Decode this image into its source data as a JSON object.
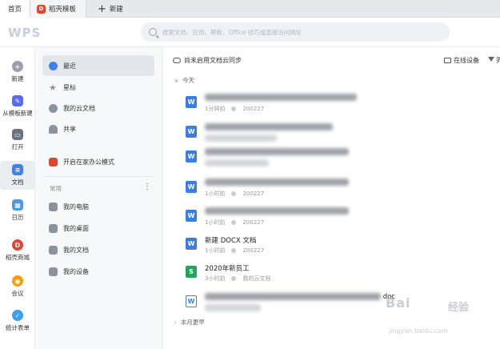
{
  "tabs": [
    {
      "label": "首页"
    },
    {
      "label": "稻壳模板"
    },
    {
      "label": "新建"
    }
  ],
  "header": {
    "logo": "WPS",
    "search_placeholder": "搜索文档、应用、模板、Office 技巧或直接访问网址"
  },
  "rail": [
    {
      "label": "新建",
      "icon": "plus-circle-icon",
      "color": "#9aa1ab"
    },
    {
      "label": "从模板新建",
      "icon": "template-new-icon",
      "color": "#5a6cf2"
    },
    {
      "label": "打开",
      "icon": "folder-icon",
      "color": "#6b7280"
    },
    {
      "label": "文档",
      "icon": "document-icon",
      "color": "#3b82f6"
    },
    {
      "label": "日历",
      "icon": "calendar-icon",
      "color": "#4b9ae8"
    },
    {
      "label": "稻壳商城",
      "icon": "docer-store-icon",
      "color": "#e5432e"
    },
    {
      "label": "会议",
      "icon": "meeting-icon",
      "color": "#f59e0b"
    },
    {
      "label": "统计表单",
      "icon": "form-stats-icon",
      "color": "#3aa0f0"
    }
  ],
  "nav": {
    "items": [
      {
        "label": "最近",
        "icon": "clock-icon",
        "color": "#3b82f6"
      },
      {
        "label": "星标",
        "icon": "star-icon",
        "color": "#8b93a0"
      },
      {
        "label": "我的云文档",
        "icon": "cloud-doc-icon",
        "color": "#8b93a0"
      },
      {
        "label": "共享",
        "icon": "share-icon",
        "color": "#8b93a0"
      },
      {
        "label": "开启在家办公模式",
        "icon": "home-office-icon",
        "color": "#e5432e"
      }
    ],
    "section_label": "常用",
    "common": [
      {
        "label": "我的电脑",
        "icon": "computer-icon"
      },
      {
        "label": "我的桌面",
        "icon": "desktop-icon"
      },
      {
        "label": "我的文档",
        "icon": "my-docs-icon"
      },
      {
        "label": "我的设备",
        "icon": "devices-icon"
      }
    ]
  },
  "main": {
    "sync_notice": "尚未启用文档云同步",
    "online_devices": "在线设备",
    "filter_label": "筛",
    "groups": [
      {
        "label": "今天"
      },
      {
        "label": "本月更早"
      }
    ],
    "files": [
      {
        "type": "W",
        "color": "#3b7ee3",
        "name": "",
        "meta": "1分钟前",
        "location": "200227"
      },
      {
        "type": "W",
        "color": "#3b7ee3",
        "name": "",
        "meta": "",
        "location": ""
      },
      {
        "type": "W",
        "color": "#3b7ee3",
        "name": "",
        "meta": "",
        "location": ""
      },
      {
        "type": "W",
        "color": "#3b7ee3",
        "name": "",
        "meta": "1小时前",
        "location": "200227"
      },
      {
        "type": "W",
        "color": "#3b7ee3",
        "name": "",
        "meta": "1小时前",
        "location": "200227"
      },
      {
        "type": "W",
        "color": "#3b7ee3",
        "name": "新建 DOCX 文档",
        "meta": "1小时前",
        "location": "200227"
      },
      {
        "type": "S",
        "color": "#22a55b",
        "name": "2020年新员工",
        "meta": "3小时前",
        "location": "我的云文档"
      },
      {
        "type": "W",
        "color": "#ffffff",
        "name": "doc",
        "meta": "",
        "location": ""
      }
    ]
  },
  "watermark": {
    "brand": "Bai",
    "cn": "经验",
    "url": "jingyan.baidu.com"
  }
}
